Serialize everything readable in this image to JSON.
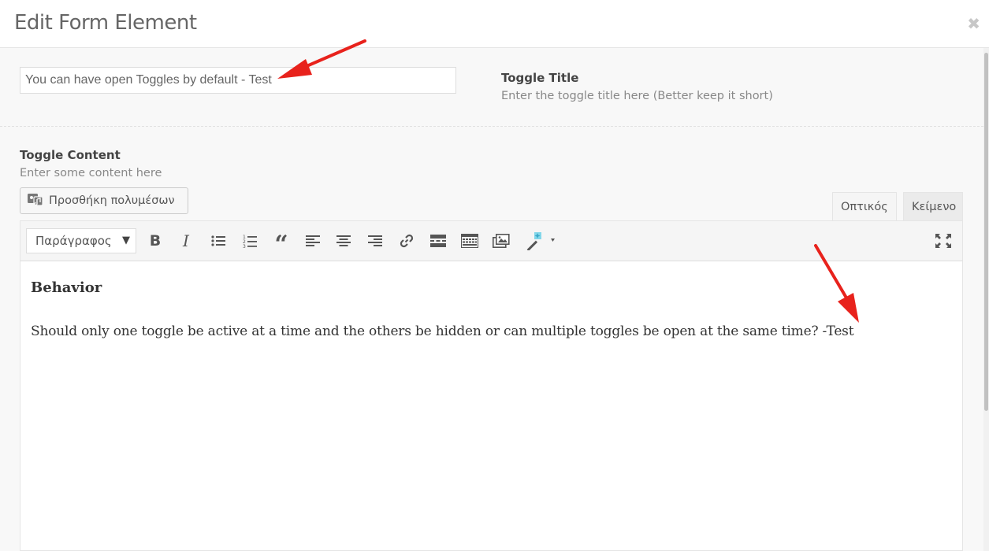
{
  "modal": {
    "title": "Edit Form Element",
    "close_icon": "close-icon"
  },
  "toggle_title": {
    "value": "You can have open Toggles by default - Test",
    "label": "Toggle Title",
    "description": "Enter the toggle title here (Better keep it short)"
  },
  "toggle_content": {
    "label": "Toggle Content",
    "description": "Enter some content here",
    "add_media_label": "Προσθήκη πολυμέσων",
    "tabs": [
      {
        "label": "Οπτικός",
        "active": true
      },
      {
        "label": "Κείμενο",
        "active": false
      }
    ],
    "format_select": "Παράγραφος",
    "toolbar_icons": [
      "bold-icon",
      "italic-icon",
      "bulleted-list-icon",
      "numbered-list-icon",
      "blockquote-icon",
      "align-left-icon",
      "align-center-icon",
      "align-right-icon",
      "link-icon",
      "read-more-icon",
      "toolbar-toggle-icon",
      "gallery-icon",
      "magic-wand-icon",
      "fullscreen-icon"
    ],
    "editor": {
      "heading": "Behavior",
      "paragraph": "Should only one toggle be active at a time and the others be hidden or can multiple toggles be open at the same time? -Test"
    }
  },
  "colors": {
    "annotation_arrow": "#e8221c"
  }
}
